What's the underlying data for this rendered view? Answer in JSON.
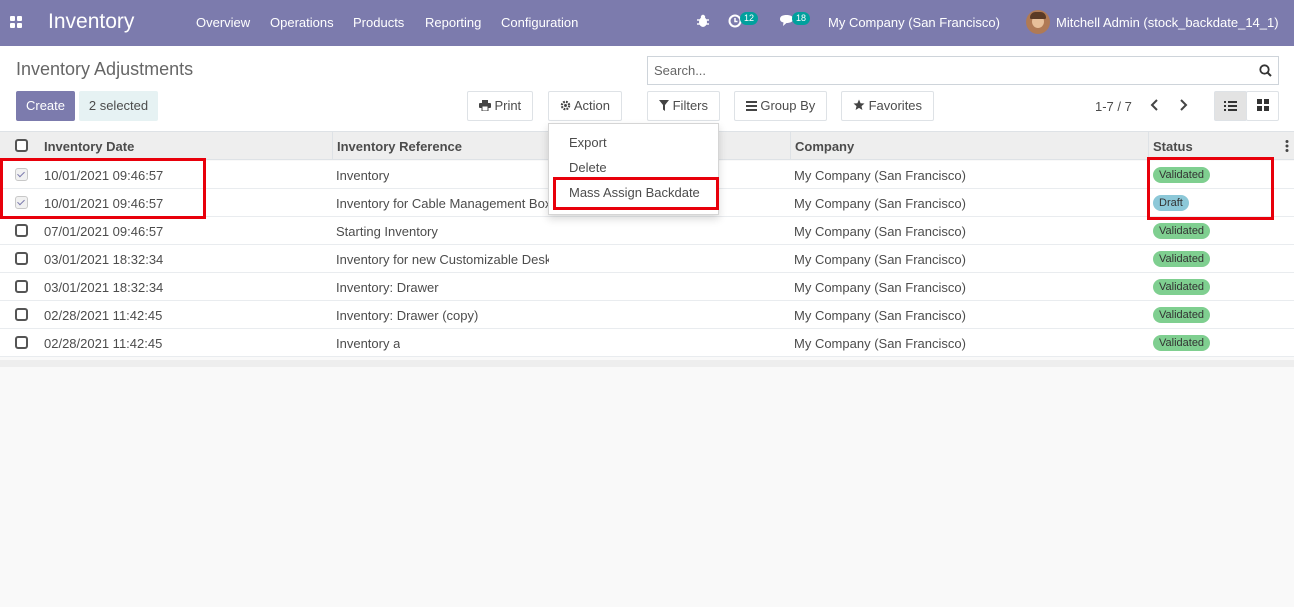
{
  "navbar": {
    "app_title": "Inventory",
    "menu": [
      "Overview",
      "Operations",
      "Products",
      "Reporting",
      "Configuration"
    ],
    "activity_count": "12",
    "messages_count": "18",
    "company": "My Company (San Francisco)",
    "user": "Mitchell Admin (stock_backdate_14_1)"
  },
  "control_panel": {
    "title": "Inventory Adjustments",
    "create_label": "Create",
    "selected_label": "2 selected",
    "print_label": "Print",
    "action_label": "Action",
    "search_placeholder": "Search...",
    "filters_label": "Filters",
    "groupby_label": "Group By",
    "favorites_label": "Favorites",
    "pager": "1-7 / 7"
  },
  "action_menu": {
    "items": [
      "Export",
      "Delete",
      "Mass Assign Backdate"
    ]
  },
  "table": {
    "columns": [
      "Inventory Date",
      "Inventory Reference",
      "Company",
      "Status"
    ],
    "rows": [
      {
        "date": "10/01/2021 09:46:57",
        "ref": "Inventory",
        "company": "My Company (San Francisco)",
        "status": "Validated",
        "checked": true
      },
      {
        "date": "10/01/2021 09:46:57",
        "ref": "Inventory for Cable Management Box",
        "company": "My Company (San Francisco)",
        "status": "Draft",
        "checked": true
      },
      {
        "date": "07/01/2021 09:46:57",
        "ref": "Starting Inventory",
        "company": "My Company (San Francisco)",
        "status": "Validated",
        "checked": false
      },
      {
        "date": "03/01/2021 18:32:34",
        "ref": "Inventory for new Customizable Desks",
        "company": "My Company (San Francisco)",
        "status": "Validated",
        "checked": false
      },
      {
        "date": "03/01/2021 18:32:34",
        "ref": "Inventory: Drawer",
        "company": "My Company (San Francisco)",
        "status": "Validated",
        "checked": false
      },
      {
        "date": "02/28/2021 11:42:45",
        "ref": "Inventory: Drawer (copy)",
        "company": "My Company (San Francisco)",
        "status": "Validated",
        "checked": false
      },
      {
        "date": "02/28/2021 11:42:45",
        "ref": "Inventory a",
        "company": "My Company (San Francisco)",
        "status": "Validated",
        "checked": false
      }
    ]
  },
  "colors": {
    "brand": "#7c7bad",
    "validated": "#7fcf90",
    "draft": "#8cc8d8",
    "highlight": "#e8000b"
  }
}
